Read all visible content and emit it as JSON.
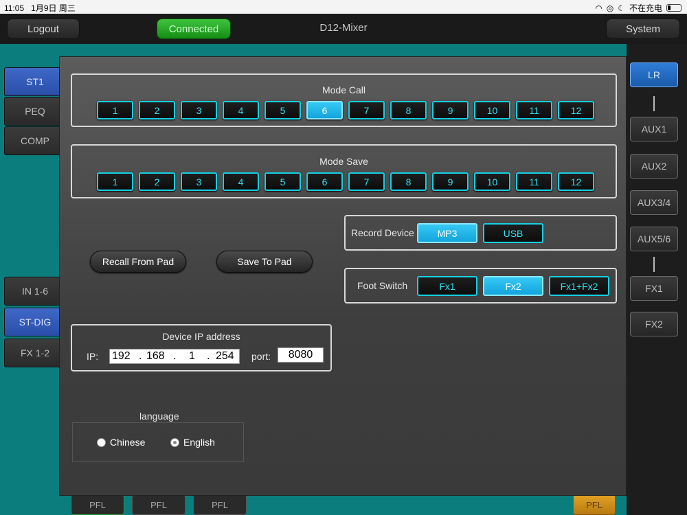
{
  "statusbar": {
    "time": "11:05",
    "date": "1月9日 周三",
    "charging": "不在充电"
  },
  "topbar": {
    "logout": "Logout",
    "connected": "Connected",
    "title": "D12-Mixer",
    "system": "System"
  },
  "left_tabs": [
    {
      "label": "ST1",
      "active": true
    },
    {
      "label": "PEQ",
      "active": false
    },
    {
      "label": "COMP",
      "active": false
    },
    {
      "label": "IN 1-6",
      "active": false
    },
    {
      "label": "ST-DIG",
      "active": true
    },
    {
      "label": "FX 1-2",
      "active": false
    }
  ],
  "right_buses": [
    {
      "label": "LR",
      "active": true
    },
    {
      "label": "AUX1",
      "active": false
    },
    {
      "label": "AUX2",
      "active": false
    },
    {
      "label": "AUX3/4",
      "active": false
    },
    {
      "label": "AUX5/6",
      "active": false
    },
    {
      "label": "FX1",
      "active": false
    },
    {
      "label": "FX2",
      "active": false
    }
  ],
  "pfl_label": "PFL",
  "mode_call": {
    "title": "Mode Call",
    "buttons": [
      "1",
      "2",
      "3",
      "4",
      "5",
      "6",
      "7",
      "8",
      "9",
      "10",
      "11",
      "12"
    ],
    "selected": "6"
  },
  "mode_save": {
    "title": "Mode Save",
    "buttons": [
      "1",
      "2",
      "3",
      "4",
      "5",
      "6",
      "7",
      "8",
      "9",
      "10",
      "11",
      "12"
    ]
  },
  "actions": {
    "recall": "Recall From Pad",
    "save": "Save To Pad"
  },
  "record_device": {
    "label": "Record Device",
    "options": [
      "MP3",
      "USB"
    ],
    "selected": "MP3"
  },
  "foot_switch": {
    "label": "Foot Switch",
    "options": [
      "Fx1",
      "Fx2",
      "Fx1+Fx2"
    ],
    "selected": "Fx2"
  },
  "device_ip": {
    "title": "Device IP address",
    "ip_label": "IP:",
    "octets": [
      "192",
      "168",
      "1",
      "254"
    ],
    "port_label": "port:",
    "port": "8080"
  },
  "language": {
    "title": "language",
    "options": [
      "Chinese",
      "English"
    ],
    "selected": "English"
  }
}
